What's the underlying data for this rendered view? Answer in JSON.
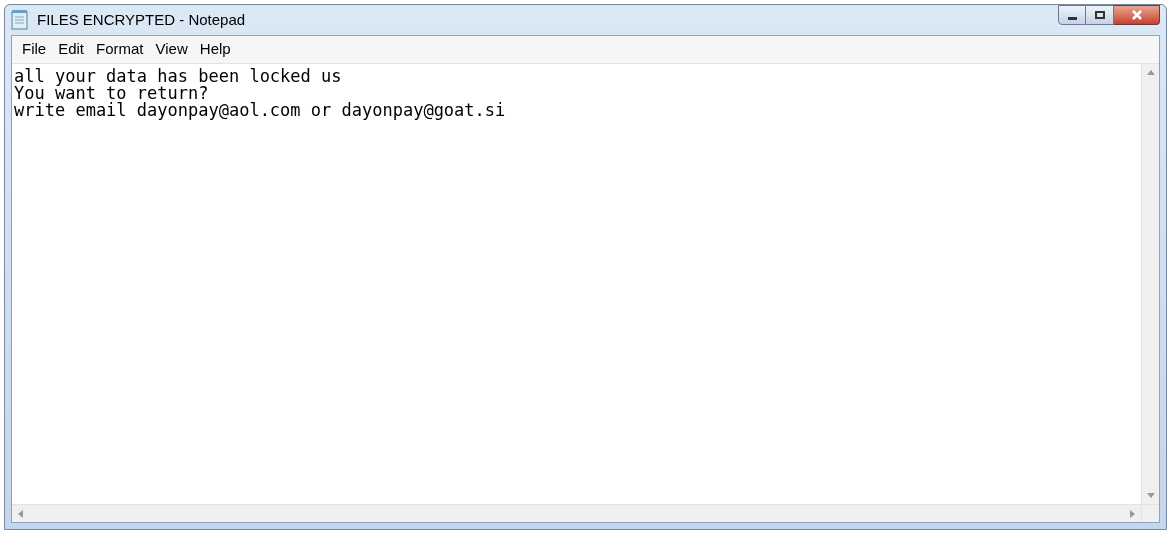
{
  "window": {
    "title": "FILES ENCRYPTED - Notepad"
  },
  "menu": [
    "File",
    "Edit",
    "Format",
    "View",
    "Help"
  ],
  "document": {
    "lines": [
      "all your data has been locked us",
      "You want to return?",
      "write email dayonpay@aol.com or dayonpay@goat.si"
    ]
  }
}
